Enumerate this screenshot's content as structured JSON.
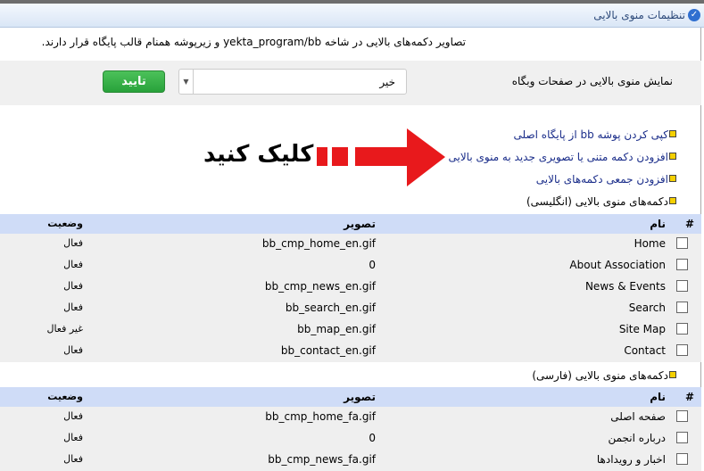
{
  "title": "تنظیمات منوی بالایی",
  "description": "تصاویر دکمه‌های بالایی در شاخه yekta_program/bb و زیرپوشه همنام قالب پایگاه قرار دارند.",
  "form": {
    "label": "نمایش منوی بالایی در صفحات وبگاه",
    "select_value": "خیر",
    "submit_label": "تایید"
  },
  "links": [
    {
      "label": "کپی کردن پوشه bb از پایگاه اصلی"
    },
    {
      "label": "افزودن دکمه متنی یا تصویری جدید به منوی بالایی"
    },
    {
      "label": "افزودن جمعی دکمه‌های بالایی"
    }
  ],
  "annotation": {
    "text": "کلیک کنید",
    "color": "#e8191c"
  },
  "columns": {
    "hash": "#",
    "name": "نام",
    "image": "تصویر",
    "status": "وضعیت"
  },
  "english": {
    "heading": "دکمه‌های منوی بالایی (انگلیسی)",
    "rows": [
      {
        "name": "Home",
        "image": "bb_cmp_home_en.gif",
        "status": "فعال"
      },
      {
        "name": "About Association",
        "image": "0",
        "status": "فعال"
      },
      {
        "name": "News & Events",
        "image": "bb_cmp_news_en.gif",
        "status": "فعال"
      },
      {
        "name": "Search",
        "image": "bb_search_en.gif",
        "status": "فعال"
      },
      {
        "name": "Site Map",
        "image": "bb_map_en.gif",
        "status": "غیر فعال"
      },
      {
        "name": "Contact",
        "image": "bb_contact_en.gif",
        "status": "فعال"
      }
    ]
  },
  "persian": {
    "heading": "دکمه‌های منوی بالایی (فارسی)",
    "rows": [
      {
        "name": "صفحه اصلی",
        "image": "bb_cmp_home_fa.gif",
        "status": "فعال"
      },
      {
        "name": "درباره انجمن",
        "image": "0",
        "status": "فعال"
      },
      {
        "name": "اخبار و رویدادها",
        "image": "bb_cmp_news_fa.gif",
        "status": "فعال"
      }
    ]
  }
}
